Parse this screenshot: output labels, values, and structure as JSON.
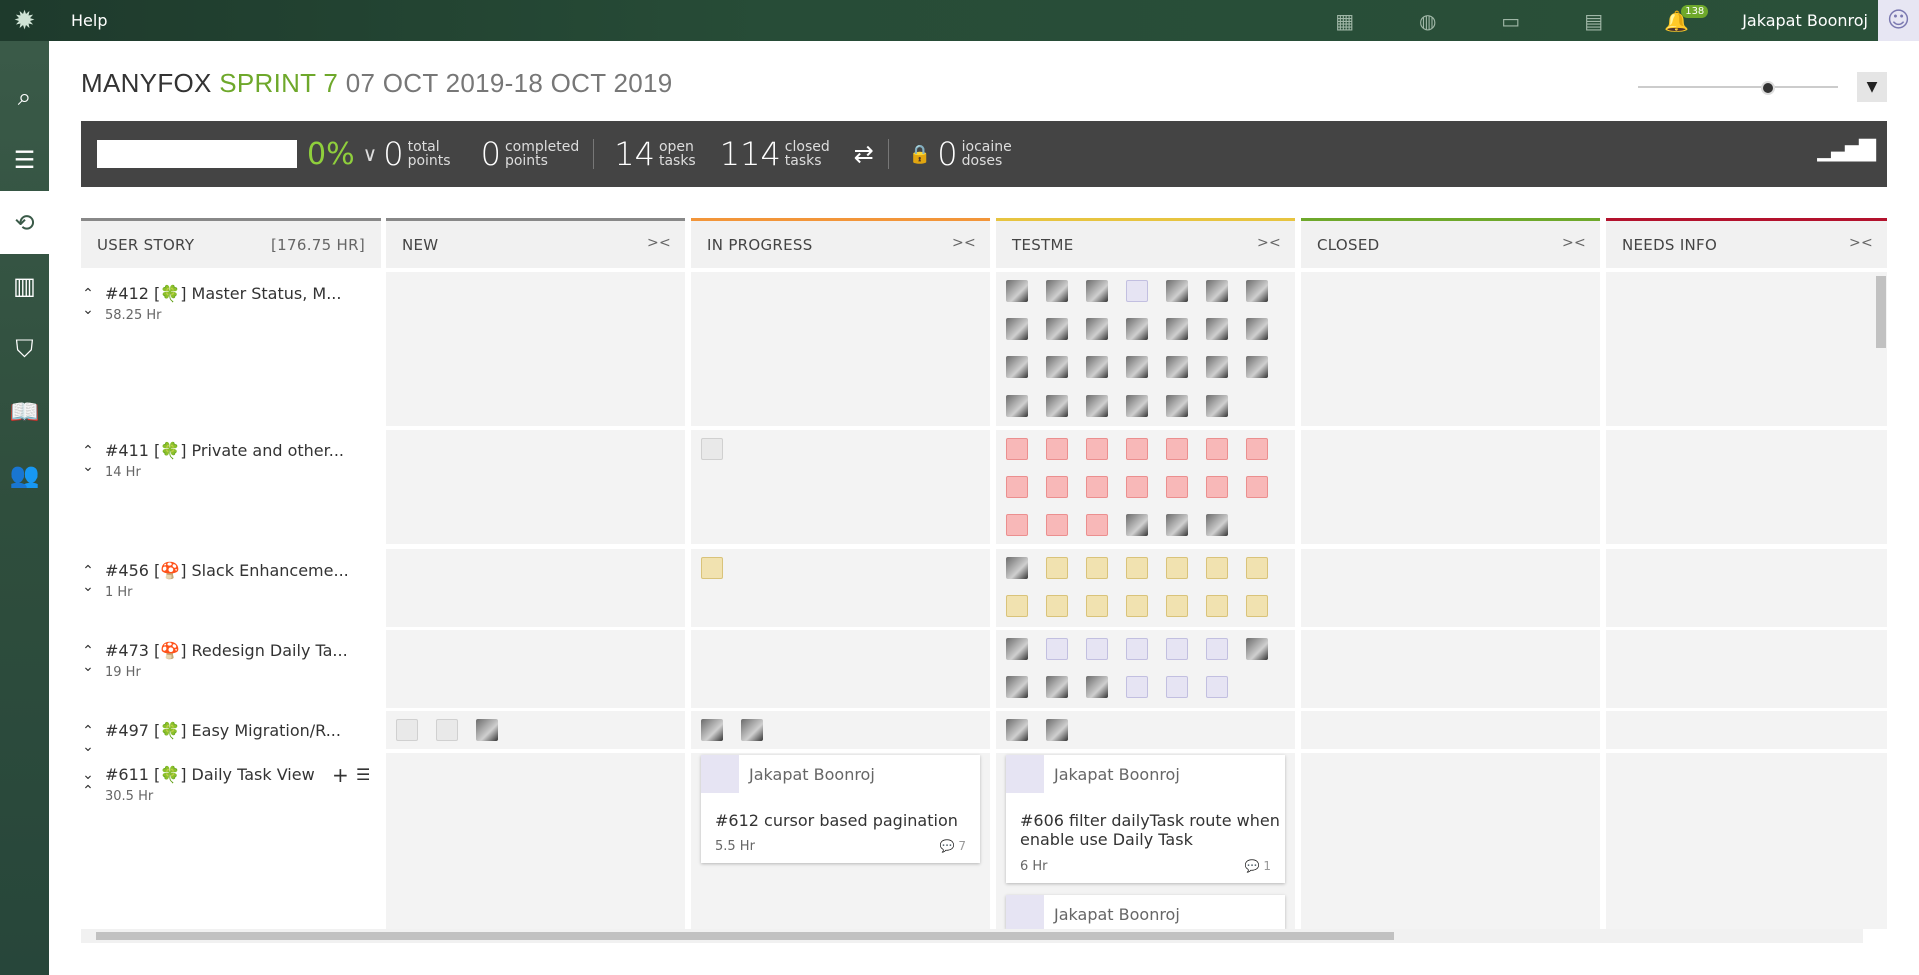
{
  "topbar": {
    "help": "Help",
    "notifications_count": "138",
    "user_name": "Jakapat Boonroj"
  },
  "header": {
    "project": "MANYFOX",
    "sprint": "SPRINT 7",
    "dates": "07 OCT 2019-18 OCT 2019"
  },
  "stats": {
    "percent": "0%",
    "total_points": "0",
    "total_points_label1": "total",
    "total_points_label2": "points",
    "completed_points": "0",
    "completed_label1": "completed",
    "completed_label2": "points",
    "open_tasks": "14",
    "open_label1": "open",
    "open_label2": "tasks",
    "closed_tasks": "114",
    "closed_label1": "closed",
    "closed_label2": "tasks",
    "iocaine": "0",
    "iocaine_label1": "iocaine",
    "iocaine_label2": "doses"
  },
  "columns": {
    "user_story": "USER STORY",
    "user_story_hours": "[176.75 HR]",
    "new": "NEW",
    "in_progress": "IN PROGRESS",
    "testme": "TESTME",
    "closed": "CLOSED",
    "needs_info": "NEEDS INFO"
  },
  "stories": [
    {
      "title": "#412 [🍀] Master Status, M...",
      "hours": "58.25 Hr"
    },
    {
      "title": "#411 [🍀] Private and other...",
      "hours": "14 Hr"
    },
    {
      "title": "#456 [🍄] Slack Enhanceme...",
      "hours": "1 Hr"
    },
    {
      "title": "#473 [🍄] Redesign Daily Ta...",
      "hours": "19 Hr"
    },
    {
      "title": "#497 [🍀] Easy Migration/R...",
      "hours": ""
    },
    {
      "title": "#611 [🍀] Daily Task View",
      "hours": "30.5 Hr"
    }
  ],
  "cards": [
    {
      "user": "Jakapat Boonroj",
      "title": "#612 cursor based pagination",
      "hours": "5.5 Hr",
      "comments": "7"
    },
    {
      "user": "Jakapat Boonroj",
      "title": "#606 filter dailyTask route when enable use Daily Task",
      "hours": "6 Hr",
      "comments": "1"
    },
    {
      "user": "Jakapat Boonroj"
    }
  ]
}
